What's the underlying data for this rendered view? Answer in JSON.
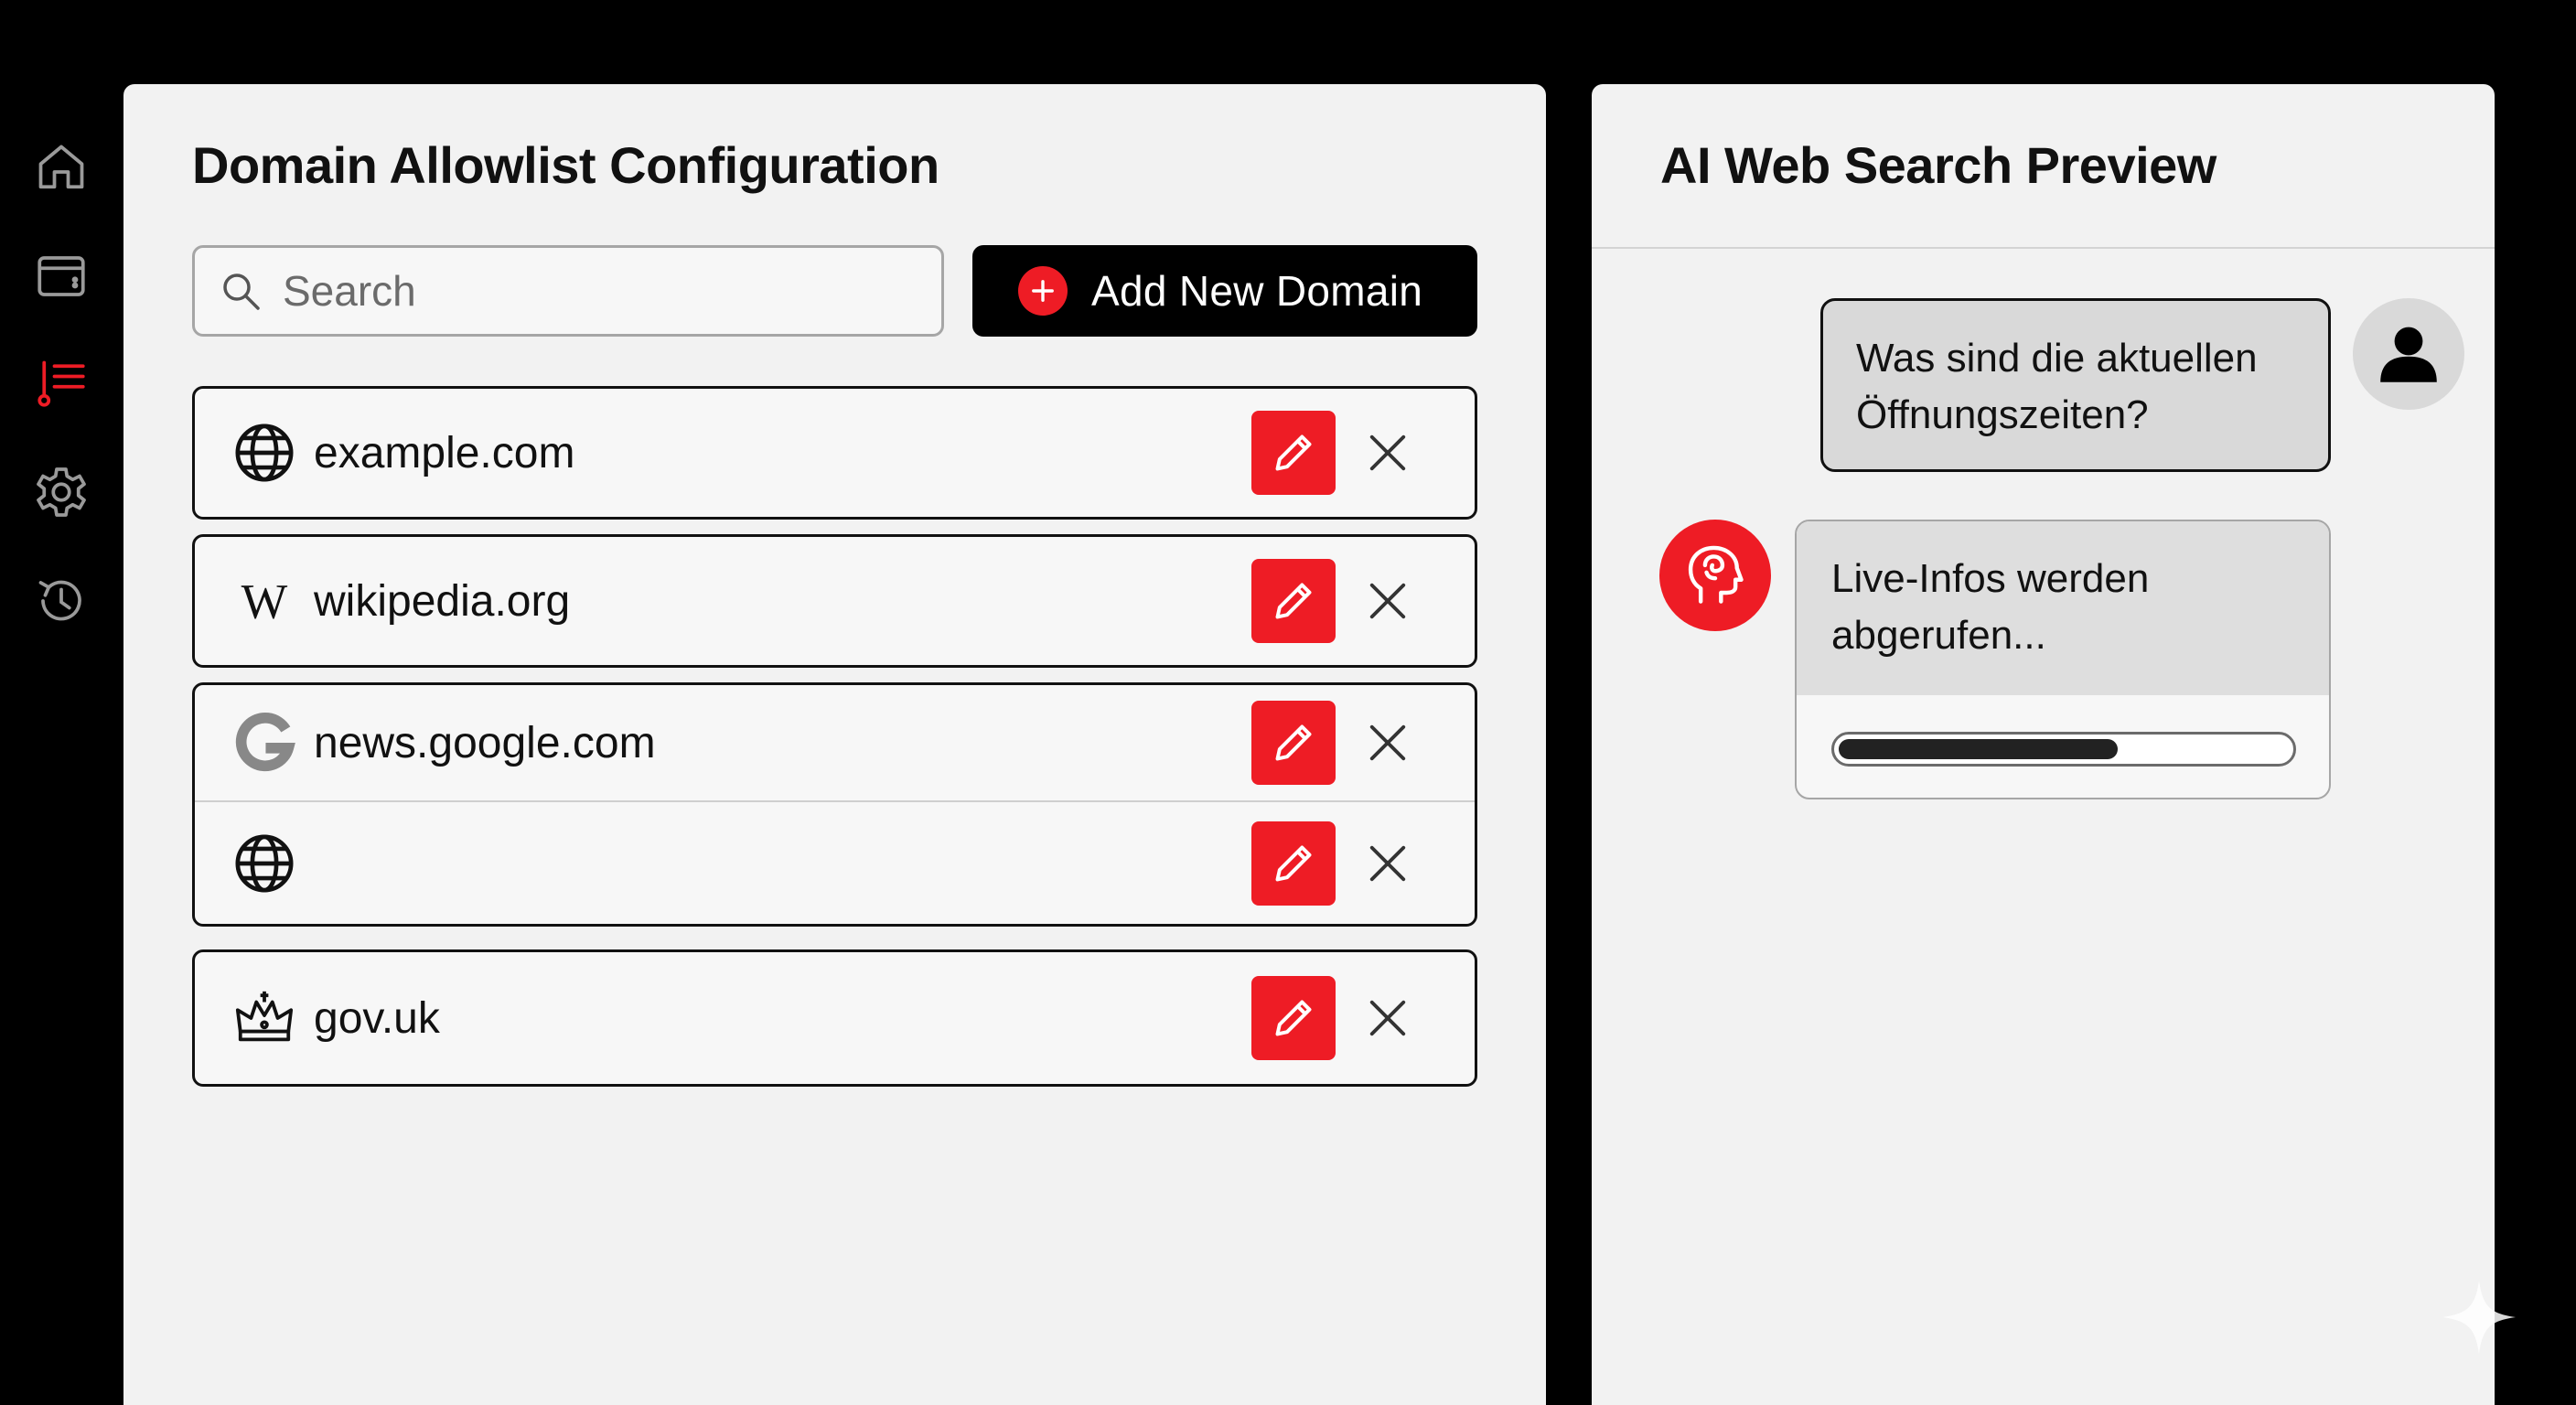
{
  "sidebar": {
    "items": [
      {
        "name": "home",
        "icon": "home-icon",
        "active": false
      },
      {
        "name": "browser",
        "icon": "browser-window-icon",
        "active": false
      },
      {
        "name": "allowlist",
        "icon": "list-icon",
        "active": true
      },
      {
        "name": "settings",
        "icon": "gear-icon",
        "active": false
      },
      {
        "name": "history",
        "icon": "history-icon",
        "active": false
      }
    ]
  },
  "left_panel": {
    "title": "Domain Allowlist Configuration",
    "search": {
      "placeholder": "Search",
      "value": ""
    },
    "add_button_label": "Add New Domain",
    "domains": [
      {
        "label": "example.com",
        "icon": "globe-icon"
      },
      {
        "label": "wikipedia.org",
        "icon": "wikipedia-icon"
      },
      {
        "label": "news.google.com",
        "icon": "google-icon"
      },
      {
        "label": "",
        "icon": "globe-icon"
      },
      {
        "label": "gov.uk",
        "icon": "crown-icon"
      }
    ]
  },
  "right_panel": {
    "title": "AI Web Search Preview",
    "user_message": {
      "line1": "Was sind die aktuellen",
      "line2": "Öffnungszeiten?"
    },
    "ai_message": {
      "line1": "Live-Infos werden",
      "line2": "abgerufen..."
    },
    "progress": 0.62
  },
  "colors": {
    "accent": "#ee1c25",
    "background": "#000000",
    "panel": "#f2f2f2",
    "bubble": "#d9d9d9"
  }
}
